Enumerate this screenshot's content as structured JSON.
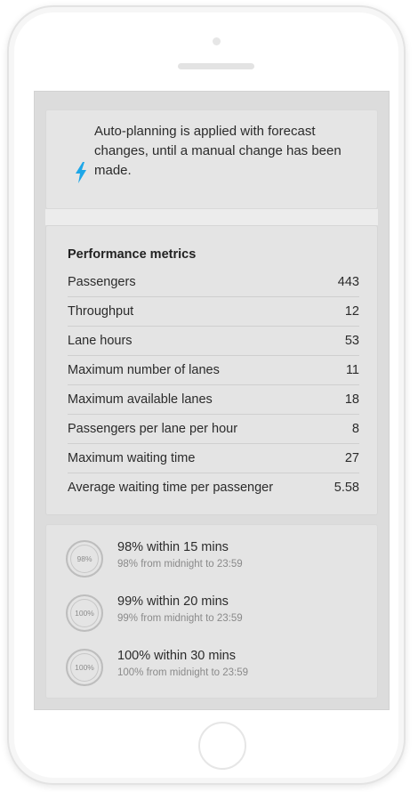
{
  "banner": {
    "text": "Auto-planning is applied with forecast changes, until a manual change has been made.",
    "icon": "lightning-icon",
    "icon_color": "#1ea7e8"
  },
  "metrics": {
    "title": "Performance metrics",
    "rows": [
      {
        "label": "Passengers",
        "value": "443"
      },
      {
        "label": "Throughput",
        "value": "12"
      },
      {
        "label": "Lane hours",
        "value": "53"
      },
      {
        "label": "Maximum number of lanes",
        "value": "11"
      },
      {
        "label": "Maximum available lanes",
        "value": "18"
      },
      {
        "label": "Passengers per lane per hour",
        "value": "8"
      },
      {
        "label": "Maximum waiting time",
        "value": "27"
      },
      {
        "label": "Average waiting time per passenger",
        "value": "5.58"
      }
    ]
  },
  "targets": [
    {
      "badge": "98%",
      "title": "98% within 15 mins",
      "subtitle": "98% from midnight to 23:59"
    },
    {
      "badge": "100%",
      "title": "99% within 20 mins",
      "subtitle": "99% from midnight to 23:59"
    },
    {
      "badge": "100%",
      "title": "100% within 30 mins",
      "subtitle": "100% from midnight to 23:59"
    }
  ]
}
